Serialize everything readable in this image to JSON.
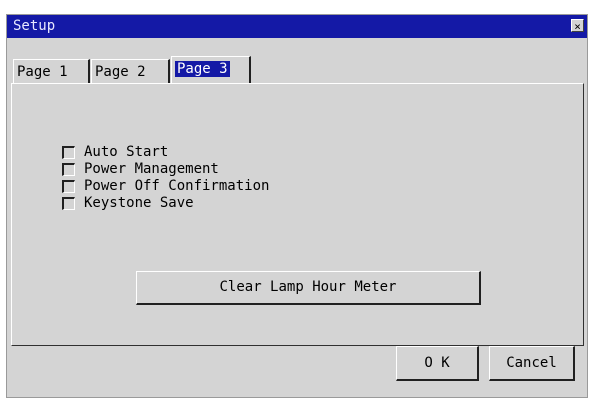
{
  "window": {
    "title": "Setup",
    "close_glyph": "×"
  },
  "tabs": [
    {
      "label": "Page 1",
      "selected": false
    },
    {
      "label": "Page 2",
      "selected": false
    },
    {
      "label": "Page 3",
      "selected": true
    }
  ],
  "options": [
    {
      "label": "Auto Start",
      "checked": false
    },
    {
      "label": "Power Management",
      "checked": false
    },
    {
      "label": "Power Off Confirmation",
      "checked": false
    },
    {
      "label": "Keystone Save",
      "checked": false
    }
  ],
  "buttons": {
    "clear_lamp": "Clear Lamp Hour Meter",
    "ok": "O K",
    "cancel": "Cancel"
  },
  "colors": {
    "titlebar": "#1419a6",
    "dialog_bg": "#d4d4d4",
    "selected_tab": "#1419a6"
  }
}
